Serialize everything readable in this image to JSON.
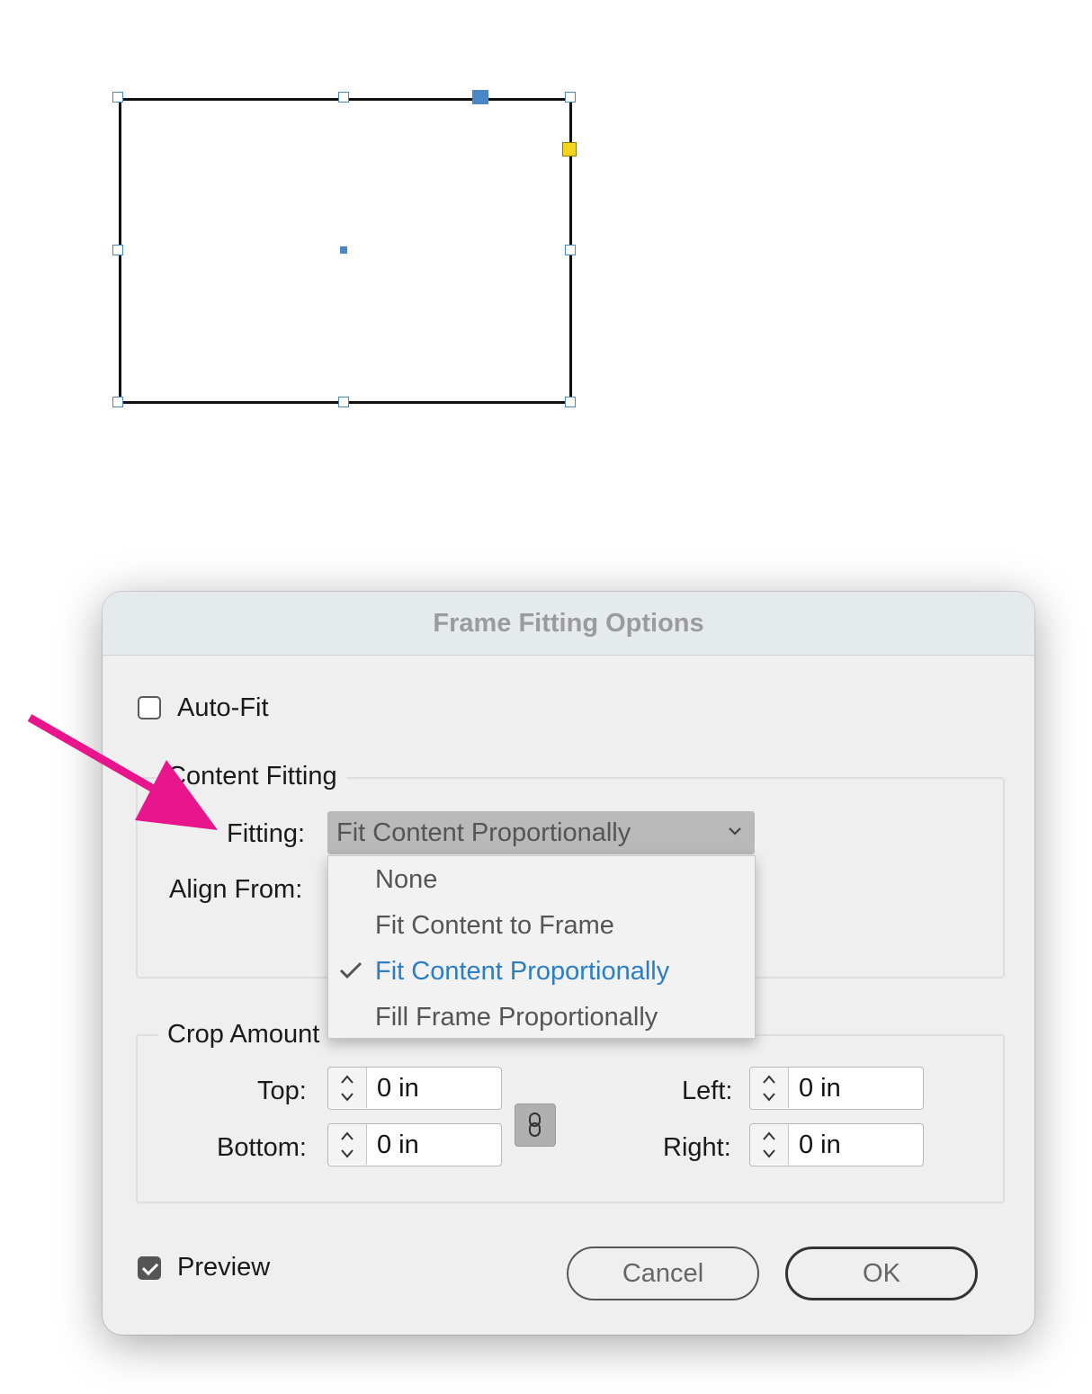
{
  "dialog": {
    "title": "Frame Fitting Options",
    "auto_fit": {
      "label": "Auto-Fit",
      "checked": false
    },
    "content_fitting": {
      "legend": "Content Fitting",
      "fitting_label": "Fitting:",
      "fitting_value": "Fit Content Proportionally",
      "align_from_label": "Align From:",
      "menu_options": [
        {
          "label": "None",
          "selected": false
        },
        {
          "label": "Fit Content to Frame",
          "selected": false
        },
        {
          "label": "Fit Content Proportionally",
          "selected": true
        },
        {
          "label": "Fill Frame Proportionally",
          "selected": false
        }
      ]
    },
    "crop_amount": {
      "legend": "Crop Amount",
      "top_label": "Top:",
      "top_value": "0 in",
      "bottom_label": "Bottom:",
      "bottom_value": "0 in",
      "left_label": "Left:",
      "left_value": "0 in",
      "right_label": "Right:",
      "right_value": "0 in"
    },
    "preview": {
      "label": "Preview",
      "checked": true
    },
    "cancel_label": "Cancel",
    "ok_label": "OK"
  },
  "colors": {
    "accent": "#2b7dc6",
    "handle": "#4a86c8",
    "annotation_arrow": "#e8158c",
    "yellow_handle": "#f4d51c"
  }
}
